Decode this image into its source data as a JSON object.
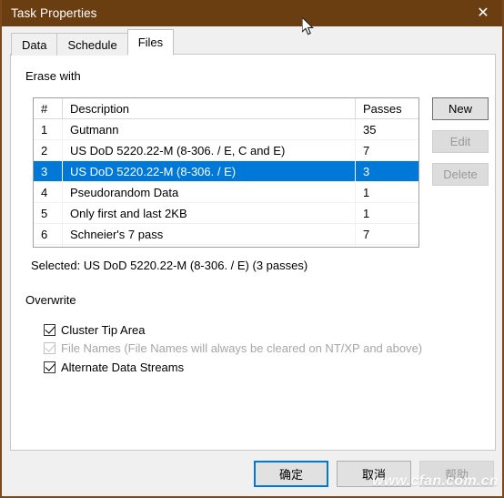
{
  "window": {
    "title": "Task Properties",
    "close_label": "✕",
    "titlebar_color": "#6b3e12"
  },
  "tabs": [
    {
      "label": "Data",
      "active": false
    },
    {
      "label": "Schedule",
      "active": false
    },
    {
      "label": "Files",
      "active": true
    }
  ],
  "sections": {
    "erase_with": "Erase with",
    "overwrite": "Overwrite",
    "selected_text": "Selected: US DoD 5220.22-M (8-306. / E) (3 passes)"
  },
  "listview": {
    "columns": [
      "#",
      "Description",
      "Passes"
    ],
    "rows": [
      {
        "num": "1",
        "description": "Gutmann",
        "passes": "35",
        "selected": false
      },
      {
        "num": "2",
        "description": "US DoD 5220.22-M (8-306. / E, C and E)",
        "passes": "7",
        "selected": false
      },
      {
        "num": "3",
        "description": "US DoD 5220.22-M (8-306. / E)",
        "passes": "3",
        "selected": true
      },
      {
        "num": "4",
        "description": "Pseudorandom Data",
        "passes": "1",
        "selected": false
      },
      {
        "num": "5",
        "description": "Only first and last 2KB",
        "passes": "1",
        "selected": false
      },
      {
        "num": "6",
        "description": "Schneier's 7 pass",
        "passes": "7",
        "selected": false
      }
    ],
    "selection_color": "#0078d7"
  },
  "side_buttons": [
    {
      "label": "New",
      "enabled": true
    },
    {
      "label": "Edit",
      "enabled": false
    },
    {
      "label": "Delete",
      "enabled": false
    }
  ],
  "checkboxes": [
    {
      "label": "Cluster Tip Area",
      "checked": true,
      "enabled": true
    },
    {
      "label": "File Names (File Names will always be cleared on NT/XP and above)",
      "checked": true,
      "enabled": false
    },
    {
      "label": "Alternate Data Streams",
      "checked": true,
      "enabled": true
    }
  ],
  "footer_buttons": [
    {
      "label": "确定",
      "default": true,
      "enabled": true
    },
    {
      "label": "取消",
      "default": false,
      "enabled": true
    },
    {
      "label": "帮助",
      "default": false,
      "enabled": false
    }
  ],
  "watermark": "www.cfan.com.cn"
}
